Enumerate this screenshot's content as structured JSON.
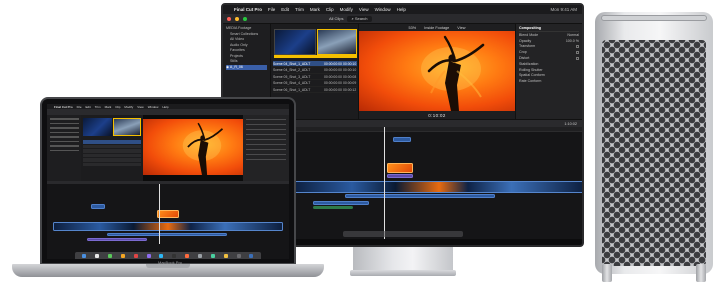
{
  "monitor": {
    "menubar": {
      "apple": "",
      "items": [
        "Final Cut Pro",
        "File",
        "Edit",
        "Trim",
        "Mark",
        "Clip",
        "Modify",
        "View",
        "Window",
        "Help"
      ],
      "status": "Mon 9:41 AM"
    },
    "toolbar": {
      "library_label": "All Clips",
      "search_placeholder": "Search"
    },
    "sidebar": {
      "items": [
        "MEDIA Footage",
        "Smart Collections",
        "All Video",
        "Audio Only",
        "Favorites",
        "Projects",
        "Stills",
        "◉ A_R_06"
      ]
    },
    "browser": {
      "clip_caption": "Scene 04_Shot_1_ADLT",
      "rows": [
        {
          "name": "Scene 04_Shot_1_ADLT",
          "start": "00:00:00:00",
          "end": "00:00:10"
        },
        {
          "name": "Scene 04_Shot_2_ADLT",
          "start": "00:00:00:00",
          "end": "00:00:10"
        },
        {
          "name": "Scene 05_Shot_3_ADLT",
          "start": "00:00:00:00",
          "end": "00:00:08"
        },
        {
          "name": "Scene 05_Shot_4_ADLT",
          "start": "00:00:00:00",
          "end": "00:00:09"
        },
        {
          "name": "Scene 06_Shot_1_ADLT",
          "start": "00:00:00:00",
          "end": "00:00:12"
        }
      ]
    },
    "viewer": {
      "title": "Inside Footage",
      "zoom": "53%",
      "view": "View",
      "timecode": "0:10:02"
    },
    "inspector": {
      "title": "Compositing",
      "rows": [
        {
          "label": "Blend Mode",
          "value": "Normal"
        },
        {
          "label": "Opacity",
          "value": "100.0 %"
        },
        {
          "label": "Transform",
          "value": ""
        },
        {
          "label": "Crop",
          "value": ""
        },
        {
          "label": "Distort",
          "value": ""
        },
        {
          "label": "Stabilization",
          "value": ""
        },
        {
          "label": "Rolling Shutter",
          "value": ""
        },
        {
          "label": "Spatial Conform",
          "value": ""
        },
        {
          "label": "Rate Conform",
          "value": ""
        }
      ]
    },
    "timeline_bar": {
      "index": "Index",
      "project": "Inside Footage",
      "clip_duration": "1:10:02"
    }
  },
  "laptop": {
    "menubar": [
      "Final Cut Pro",
      "File",
      "Edit",
      "Trim",
      "Mark",
      "Clip",
      "Modify",
      "View",
      "Window",
      "Help"
    ],
    "brand": "MacBook Pro"
  },
  "colors": {
    "accent_blue": "#2d5aa0",
    "clip_purple": "#5a4aa8",
    "video_orange": "#f24d0a",
    "selection": "#2f4f86",
    "tower_silver": "#e9eaec"
  },
  "icons": [
    "apple-icon",
    "search-icon",
    "window-close-icon",
    "window-minimize-icon",
    "window-zoom-icon"
  ]
}
